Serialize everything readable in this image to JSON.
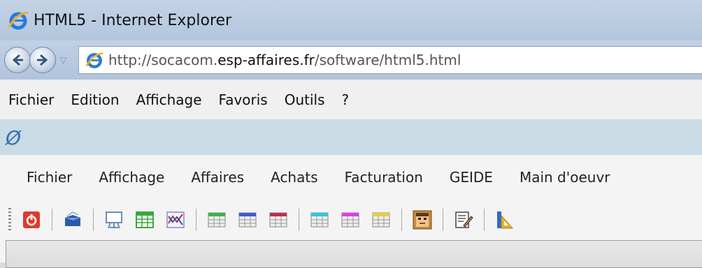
{
  "window": {
    "title": "HTML5 - Internet Explorer"
  },
  "address_bar": {
    "url_prefix": "http://socacom.",
    "url_domain": "esp-affaires.fr",
    "url_path": "/software/html5.html"
  },
  "browser_menu": {
    "items": [
      "Fichier",
      "Edition",
      "Affichage",
      "Favoris",
      "Outils",
      "?"
    ]
  },
  "favorites_bar": {
    "icon": "null-symbol-icon"
  },
  "app_menu": {
    "items": [
      "Fichier",
      "Affichage",
      "Affaires",
      "Achats",
      "Facturation",
      "GEIDE",
      "Main d'oeuvr"
    ]
  },
  "toolbar": {
    "buttons": [
      {
        "icon": "power-icon",
        "color": "#e03a2a"
      },
      {
        "icon": "open-box-icon",
        "color": "#2a5aa8"
      },
      {
        "icon": "presentation-icon",
        "color": "#6a8fb8"
      },
      {
        "icon": "spreadsheet-green-icon",
        "color": "#3aa83a"
      },
      {
        "icon": "chart-icon",
        "color": "#c03030"
      },
      {
        "icon": "grid-green-icon",
        "color": "#3cb44a"
      },
      {
        "icon": "grid-blue-icon",
        "color": "#3a5bd0"
      },
      {
        "icon": "grid-red-icon",
        "color": "#c0304a"
      },
      {
        "icon": "grid-cyan-icon",
        "color": "#33c6d8"
      },
      {
        "icon": "grid-magenta-icon",
        "color": "#e040e0"
      },
      {
        "icon": "grid-yellow-icon",
        "color": "#e8d040"
      },
      {
        "icon": "user-face-icon",
        "color": "#c98a3a"
      },
      {
        "icon": "edit-note-icon",
        "color": "#555555"
      },
      {
        "icon": "design-ruler-icon",
        "color": "#2a6ad0"
      }
    ]
  },
  "colors": {
    "chrome_blue": "#b9cbe0",
    "favbar": "#c9dce6"
  }
}
